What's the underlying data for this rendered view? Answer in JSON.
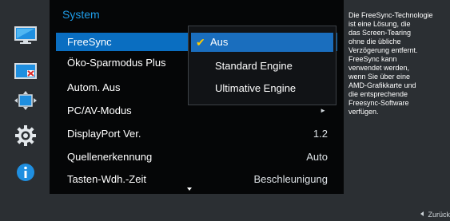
{
  "sidebar": {
    "icons": [
      "monitor-icon",
      "picture-icon",
      "move-icon",
      "gear-icon",
      "info-icon"
    ]
  },
  "menu": {
    "title": "System",
    "items": [
      {
        "label": "FreeSync",
        "value": "",
        "selected": true
      },
      {
        "label": "Öko-Sparmodus Plus",
        "value": ""
      },
      {
        "label": "Autom. Aus",
        "value": ""
      },
      {
        "label": "PC/AV-Modus",
        "value": "",
        "arrow": "►"
      },
      {
        "label": "DisplayPort Ver.",
        "value": "1.2"
      },
      {
        "label": "Quellenerkennung",
        "value": "Auto"
      },
      {
        "label": "Tasten-Wdh.-Zeit",
        "value": "Beschleunigung"
      }
    ]
  },
  "dropdown": {
    "check": "✔",
    "options": [
      {
        "label": "Aus",
        "selected": true
      },
      {
        "label": "Standard Engine"
      },
      {
        "label": "Ultimative Engine"
      }
    ]
  },
  "help": {
    "text": "Die FreeSync-Technologie\nist eine Lösung, die\ndas Screen-Tearing\nohne die übliche\nVerzögerung entfernt.\nFreeSync kann\nverwendet werden,\nwenn Sie über eine\nAMD-Grafikkarte und\ndie entsprechende\nFreesync-Software\nverfügen."
  },
  "footer": {
    "back_label": "Zurück"
  },
  "colors": {
    "accent_blue": "#1e9ce8",
    "selection_blue": "#0a6ec1",
    "check_yellow": "#ffcc00",
    "panel_gray": "#2b2f33"
  }
}
